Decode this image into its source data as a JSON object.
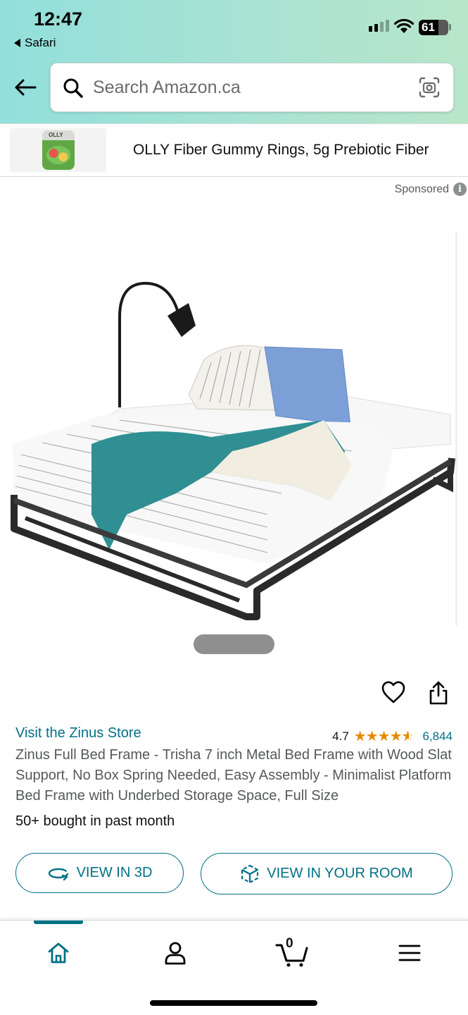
{
  "status_bar": {
    "time": "12:47",
    "back_app": "Safari",
    "battery": "61"
  },
  "search": {
    "placeholder": "Search Amazon.ca"
  },
  "ad_banner": {
    "title": "OLLY Fiber Gummy Rings, 5g Prebiotic Fiber",
    "thumb_brand": "OLLY"
  },
  "sponsored": {
    "label": "Sponsored",
    "info_glyph": "i"
  },
  "product": {
    "store_link": "Visit the Zinus Store",
    "rating_value": "4.7",
    "rating_stars": 4.7,
    "rating_count": "6,844",
    "title": "Zinus Full Bed Frame - Trisha 7 inch Metal Bed Frame with Wood Slat Support, No Box Spring Needed, Easy Assembly - Minimalist Platform Bed Frame with Underbed Storage Space, Full Size",
    "bought": "50+ bought in past month"
  },
  "buttons": {
    "view_3d": "VIEW IN 3D",
    "view_room": "VIEW IN YOUR ROOM"
  },
  "bottom_nav": {
    "cart_count": "0",
    "items": [
      {
        "icon": "home-icon",
        "active": true
      },
      {
        "icon": "account-icon",
        "active": false
      },
      {
        "icon": "cart-icon",
        "active": false
      },
      {
        "icon": "menu-icon",
        "active": false
      }
    ]
  },
  "colors": {
    "link": "#007185",
    "star": "#e68a00",
    "topbar_start": "#92dfdb",
    "topbar_end": "#b8e6c9"
  }
}
